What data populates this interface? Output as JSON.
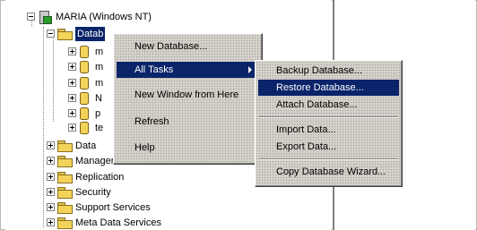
{
  "tree": {
    "server": "MARIA (Windows NT)",
    "databases_label": "Databases",
    "databases_label_visible": "Datab",
    "db_items": [
      "m",
      "m",
      "m",
      "N",
      "p",
      "te"
    ],
    "items": [
      "Data",
      "Management",
      "Replication",
      "Security",
      "Support Services",
      "Meta Data Services"
    ]
  },
  "context_menu": {
    "items": [
      "New Database...",
      "All Tasks",
      "New Window from Here",
      "Refresh",
      "Help"
    ],
    "highlighted": "All Tasks"
  },
  "submenu": {
    "items": [
      "Backup Database...",
      "Restore Database...",
      "Attach Database...",
      "Import Data...",
      "Export Data...",
      "Copy Database Wizard..."
    ],
    "highlighted": "Restore Database..."
  },
  "colors": {
    "highlight": "#0a246a",
    "menu_bg": "#d4d0c8",
    "folder": "#f3d35a"
  }
}
